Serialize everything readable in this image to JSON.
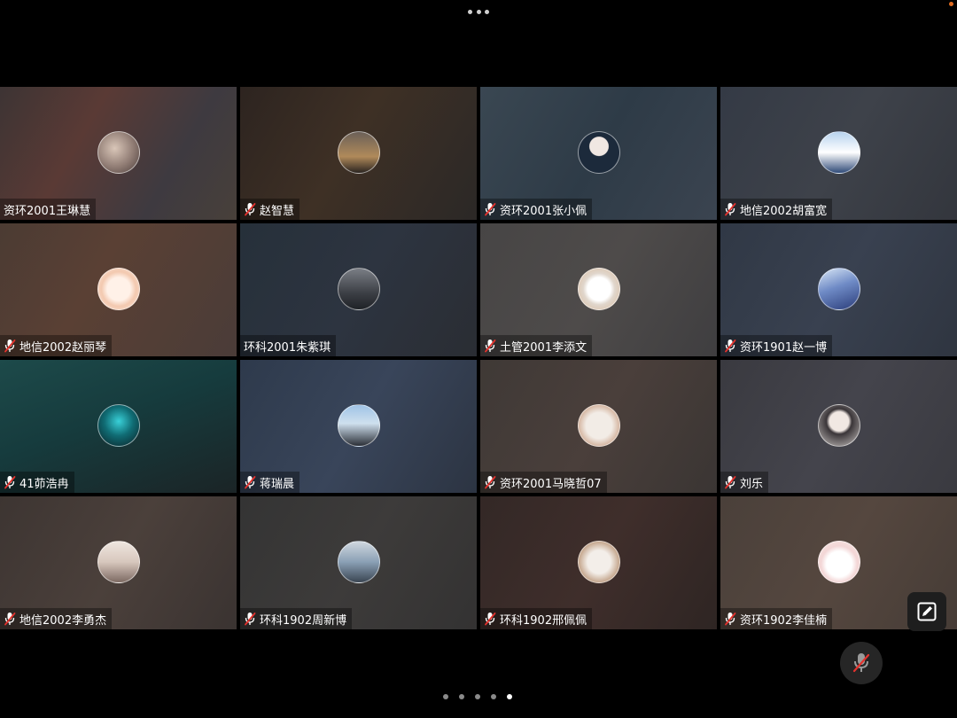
{
  "participants": [
    {
      "name": "资环2001王琳慧",
      "muted": false,
      "bg": "linear-gradient(120deg,#3d3434 0%,#5a3a35 35%,#3e3a40 70%,#48403a 100%)",
      "avatar": "radial-gradient(circle at 40% 40%,#d9c6b8,#8f7b73 55%,#4a3c3a)"
    },
    {
      "name": "赵智慧",
      "muted": true,
      "bg": "linear-gradient(120deg,#2d2420 0%,#3e3025 45%,#2b2826 100%)",
      "avatar": "linear-gradient(180deg,#6b6058 0%,#b08a5a 60%,#2a2420 100%)"
    },
    {
      "name": "资环2001张小佩",
      "muted": true,
      "bg": "linear-gradient(120deg,#3a4752 0%,#2e3b47 50%,#3b4450 100%)",
      "avatar": "radial-gradient(circle at 50% 35%,#f0e7e2 0 28%,#1c2a3b 30% 100%)"
    },
    {
      "name": "地信2002胡富宽",
      "muted": true,
      "bg": "linear-gradient(120deg,#343a45 0%,#3e424a 50%,#33363d 100%)",
      "avatar": "linear-gradient(180deg,#b8d3ee 0%,#ffffff 50%,#2f4a78 100%)"
    },
    {
      "name": "地信2002赵丽琴",
      "muted": true,
      "bg": "linear-gradient(120deg,#4b3b33 0%,#5a4034 40%,#4a3c38 100%)",
      "avatar": "radial-gradient(circle at 50% 50%,#fff1e8 0 40%,#f3c9b0 60%,#f7e5d9 100%)"
    },
    {
      "name": "环科2001朱紫琪",
      "muted": false,
      "bg": "linear-gradient(120deg,#26303a 0%,#2d3440 50%,#2a2d33 100%)",
      "avatar": "linear-gradient(180deg,#7a7e85 0%,#3c3f45 60%,#1f2227 100%)"
    },
    {
      "name": "土管2001李添文",
      "muted": true,
      "bg": "linear-gradient(120deg,#474545 0%,#4e4b4a 50%,#3f3e40 100%)",
      "avatar": "radial-gradient(circle at 50% 50%,#ffffff 0 40%,#e0d6cc 55%,#d9b99a 100%)"
    },
    {
      "name": "资环1901赵一博",
      "muted": true,
      "bg": "linear-gradient(120deg,#303845 0%,#394150 50%,#2f3540 100%)",
      "avatar": "linear-gradient(160deg,#d8e6f5 0%,#6f8bc6 45%,#2b3d7a 100%)"
    },
    {
      "name": "41茆浩冉",
      "muted": true,
      "bg": "linear-gradient(160deg,#1d4a4a 0%,#163b3d 45%,#1b2426 100%)",
      "avatar": "radial-gradient(circle at 50% 40%,#39d0d8 0%,#106c74 45%,#0a1f24 100%)"
    },
    {
      "name": "蒋瑞晨",
      "muted": true,
      "bg": "linear-gradient(120deg,#2e3a4c 0%,#39455a 50%,#2c3442 100%)",
      "avatar": "linear-gradient(180deg,#9fc3e6 0%,#cfe0ee 45%,#2a2e36 100%)"
    },
    {
      "name": "资环2001马晓哲07",
      "muted": true,
      "bg": "linear-gradient(120deg,#3f3936 0%,#4a3f3b 50%,#3a3533 100%)",
      "avatar": "radial-gradient(circle at 50% 50%,#f2ece6 0 45%,#d6b8a4 70%,#a98b7b 100%)"
    },
    {
      "name": "刘乐",
      "muted": true,
      "bg": "linear-gradient(120deg,#3a3a40 0%,#44444c 50%,#3a3a40 100%)",
      "avatar": "radial-gradient(circle at 50% 40%,#f1e8e3 0 30%,#3a3538 40%,#c9c4c2 100%)"
    },
    {
      "name": "地信2002李勇杰",
      "muted": true,
      "bg": "linear-gradient(120deg,#3d3532 0%,#4b403b 50%,#3a3331 100%)",
      "avatar": "linear-gradient(180deg,#efe6df 0%,#d7c7bd 50%,#7d6a62 100%)"
    },
    {
      "name": "环科1902周新博",
      "muted": true,
      "bg": "linear-gradient(120deg,#343434 0%,#3d3b3a 50%,#333232 100%)",
      "avatar": "linear-gradient(180deg,#cfd7df 0%,#8aa0b5 50%,#3a4552 100%)"
    },
    {
      "name": "环科1902邢佩佩",
      "muted": true,
      "bg": "linear-gradient(120deg,#332826 0%,#3f2e2b 50%,#2e2523 100%)",
      "avatar": "radial-gradient(circle at 50% 50%,#f3eee9 0 40%,#c5a78e 70%,#7c5f4b 100%)"
    },
    {
      "name": "资环1902李佳楠",
      "muted": true,
      "bg": "linear-gradient(120deg,#4a403a 0%,#55473f 50%,#463c36 100%)",
      "avatar": "radial-gradient(circle at 50% 55%,#ffffff 0 42%,#f3d6d6 60%,#f5e9e4 100%)"
    }
  ],
  "pagination": {
    "total": 5,
    "active": 4
  },
  "colors": {
    "mic_red": "#e5322d"
  }
}
